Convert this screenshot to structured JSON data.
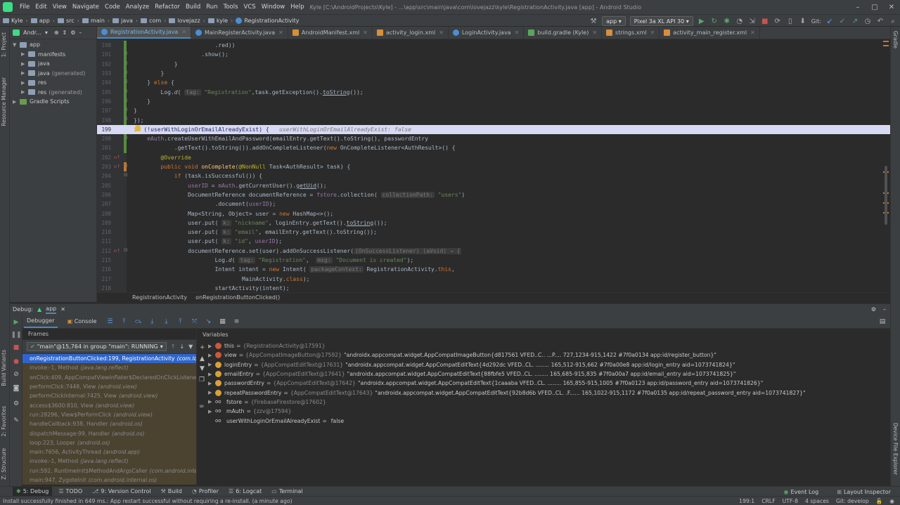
{
  "menu": {
    "items": [
      "File",
      "Edit",
      "View",
      "Navigate",
      "Code",
      "Analyze",
      "Refactor",
      "Build",
      "Run",
      "Tools",
      "VCS",
      "Window",
      "Help"
    ],
    "title": "Kyle [C:\\AndroidProjects\\Kyle] - ...\\app\\src\\main\\java\\com\\lovejazz\\kyle\\RegistrationActivity.java [app] - Android Studio"
  },
  "navbar": {
    "crumbs": [
      "Kyle",
      "app",
      "src",
      "main",
      "java",
      "com",
      "lovejazz",
      "kyle",
      "RegistrationActivity"
    ],
    "run_config": "app",
    "device": "Pixel 3a XL API 30",
    "git_label": "Git:"
  },
  "left_stripe": [
    "1: Project",
    "Resource Manager",
    "Build Variants",
    "2: Favorites",
    "Z: Structure"
  ],
  "right_stripe": [
    "Gradle",
    "Device File Explorer"
  ],
  "project": {
    "header": "Andr...",
    "tree": [
      {
        "label": "app",
        "indent": 0,
        "expanded": true,
        "type": "folder"
      },
      {
        "label": "manifests",
        "indent": 1,
        "expanded": false,
        "type": "folder"
      },
      {
        "label": "java",
        "indent": 1,
        "expanded": false,
        "type": "folder"
      },
      {
        "label": "java",
        "suffix": "(generated)",
        "indent": 1,
        "expanded": false,
        "type": "folder"
      },
      {
        "label": "res",
        "indent": 1,
        "expanded": false,
        "type": "folder"
      },
      {
        "label": "res",
        "suffix": "(generated)",
        "indent": 1,
        "expanded": false,
        "type": "folder"
      },
      {
        "label": "Gradle Scripts",
        "indent": 0,
        "expanded": false,
        "type": "gradle"
      }
    ]
  },
  "tabs": [
    {
      "label": "RegistrationActivity.java",
      "icon": "class",
      "active": true
    },
    {
      "label": "MainRegisterActivity.java",
      "icon": "class",
      "active": false
    },
    {
      "label": "AndroidManifest.xml",
      "icon": "xml",
      "active": false
    },
    {
      "label": "activity_login.xml",
      "icon": "xml",
      "active": false
    },
    {
      "label": "LoginActivity.java",
      "icon": "class",
      "active": false
    },
    {
      "label": "build.gradle (Kyle)",
      "icon": "gradle",
      "active": false
    },
    {
      "label": "strings.xml",
      "icon": "xml",
      "active": false
    },
    {
      "label": "activity_main_register.xml",
      "icon": "xml",
      "active": false
    }
  ],
  "code": [
    {
      "n": "190",
      "html": "                        .red))"
    },
    {
      "n": "191",
      "html": "                    .show();"
    },
    {
      "n": "192",
      "html": "            }"
    },
    {
      "n": "193",
      "html": "        }"
    },
    {
      "n": "194",
      "html": "    } <k>else</k> {"
    },
    {
      "n": "195",
      "html": "        Log.<i>d</i>( <h>tag:</h> <s>\"Registration\"</s>,task.getException().<u>toString</u>());"
    },
    {
      "n": "196",
      "html": "    }"
    },
    {
      "n": "197",
      "html": "}"
    },
    {
      "n": "198",
      "html": "});"
    },
    {
      "n": "199",
      "html": "<k>if</k> (!userWithLoginOrEmailAlreadyExist) {   <c>userWithLoginOrEmailAlreadyExist: false</c>",
      "exec": true
    },
    {
      "n": "200",
      "html": "    <f>mAuth</f>.createUserWithEmailAndPassword(emailEntry.getText().toString(), passwordEntry"
    },
    {
      "n": "201",
      "html": "            .getText().toString()).addOnCompleteListener(<k>new</k> OnCompleteListener&lt;AuthResult&gt;() {"
    },
    {
      "n": "202",
      "html": "        <a>@Override</a>"
    },
    {
      "n": "203",
      "html": "        <k>public void</k> <y>onComplete</y>(<a>@NonNull</a> Task&lt;AuthResult&gt; task) {"
    },
    {
      "n": "204",
      "html": "            <k>if</k> (task.isSuccessful()) {"
    },
    {
      "n": "205",
      "html": "                <f>userID</f> = <f>mAuth</f>.getCurrentUser().<u>getUid</u>();"
    },
    {
      "n": "206",
      "html": "                DocumentReference documentReference = <f>fstore</f>.collection( <h>collectionPath:</h> <s>\"users\"</s>)"
    },
    {
      "n": "207",
      "html": "                        .document(<f>userID</f>);"
    },
    {
      "n": "208",
      "html": "                Map&lt;String, Object&gt; user = <k>new</k> HashMap&lt;&gt;();"
    },
    {
      "n": "209",
      "html": "                user.put( <h>k:</h> <s>\"nickname\"</s>, loginEntry.getText().<u>toString</u>());"
    },
    {
      "n": "210",
      "html": "                user.put( <h>k:</h> <s>\"email\"</s>, emailEntry.getText().toString());"
    },
    {
      "n": "211",
      "html": "                user.put( <h>k:</h> <s>\"id\"</s>, <f>userID</f>);"
    },
    {
      "n": "212",
      "html": "                documentReference.set(user).addOnSuccessListener(<h>(OnSuccessListener) (aVoid) → {</h>"
    },
    {
      "n": "215",
      "html": "                        Log.<i>d</i>( <h>tag:</h> <s>\"Registration\"</s>,  <h>msg:</h> <s>\"Document is created\"</s>);"
    },
    {
      "n": "216",
      "html": "                        Intent intent = <k>new</k> Intent( <h>packageContext:</h> RegistrationActivity.<k>this</k>,"
    },
    {
      "n": "217",
      "html": "                                MainActivity.<k>class</k>);"
    },
    {
      "n": "218",
      "html": "                        startActivity(intent);"
    }
  ],
  "editor_breadcrumb": [
    "RegistrationActivity",
    "onRegistrationButtonClicked()"
  ],
  "debug": {
    "label": "Debug:",
    "config": "app",
    "tabs": [
      "Debugger",
      "Console"
    ],
    "frames_title": "Frames",
    "variables_title": "Variables",
    "thread": "\"main\"@15,764 in group \"main\": RUNNING",
    "frames": [
      {
        "text": "onRegistrationButtonClicked:199, RegistrationActivity",
        "pkg": "(com.lovejazz",
        "selected": true
      },
      {
        "text": "invoke:-1, Method",
        "pkg": "(java.lang.reflect)",
        "selected": false
      },
      {
        "text": "onClick:409, AppCompatViewInflater$DeclaredOnClickListener",
        "pkg": "(an",
        "selected": false
      },
      {
        "text": "performClick:7448, View",
        "pkg": "(android.view)",
        "selected": false
      },
      {
        "text": "performClickInternal:7425, View",
        "pkg": "(android.view)",
        "selected": false
      },
      {
        "text": "access$3600:810, View",
        "pkg": "(android.view)",
        "selected": false
      },
      {
        "text": "run:28296, View$PerformClick",
        "pkg": "(android.view)",
        "selected": false
      },
      {
        "text": "handleCallback:938, Handler",
        "pkg": "(android.os)",
        "selected": false
      },
      {
        "text": "dispatchMessage:99, Handler",
        "pkg": "(android.os)",
        "selected": false
      },
      {
        "text": "loop:223, Looper",
        "pkg": "(android.os)",
        "selected": false
      },
      {
        "text": "main:7656, ActivityThread",
        "pkg": "(android.app)",
        "selected": false
      },
      {
        "text": "invoke:-1, Method",
        "pkg": "(java.lang.reflect)",
        "selected": false
      },
      {
        "text": "run:592, RuntimeInit$MethodAndArgsCaller",
        "pkg": "(com.android.internal",
        "selected": false
      },
      {
        "text": "main:947, ZygoteInit",
        "pkg": "(com.android.internal.os)",
        "selected": false
      }
    ],
    "variables": [
      {
        "name": "this",
        "type": "{RegistrationActivity@17591}",
        "value": "",
        "icon": "t",
        "expand": true
      },
      {
        "name": "view",
        "type": "{AppCompatImageButton@17592}",
        "value": "\"androidx.appcompat.widget.AppCompatImageButton{d817561 VFED..C.. ...P.... 727,1234-915,1422 #7f0a0134 app:id/register_button}\"",
        "icon": "t",
        "expand": true
      },
      {
        "name": "loginEntry",
        "type": "{AppCompatEditText@17631}",
        "value": "\"androidx.appcompat.widget.AppCompatEditText{4d292dc VFED..CL. ........ 165,512-915,662 #7f0a00e8 app:id/login_entry aid=1073741824}\"",
        "icon": "f",
        "expand": true
      },
      {
        "name": "emailEntry",
        "type": "{AppCompatEditText@17641}",
        "value": "\"androidx.appcompat.widget.AppCompatEditText{88fbfe5 VFED..CL. ........ 165,685-915,835 #7f0a00a7 app:id/email_entry aid=1073741825}\"",
        "icon": "f",
        "expand": true
      },
      {
        "name": "passwordEntry",
        "type": "{AppCompatEditText@17642}",
        "value": "\"androidx.appcompat.widget.AppCompatEditText{1caaaba VFED..CL. ........ 165,855-915,1005 #7f0a0123 app:id/password_entry aid=1073741826}\"",
        "icon": "f",
        "expand": true
      },
      {
        "name": "repeatPasswordEntry",
        "type": "{AppCompatEditText@17643}",
        "value": "\"androidx.appcompat.widget.AppCompatEditText{92b8d6b VFED..CL. .F...... 165,1022-915,1172 #7f0a0135 app:id/repeat_password_entry aid=1073741827}\"",
        "icon": "f",
        "expand": true
      },
      {
        "name": "fstore",
        "type": "{FirebaseFirestore@17602}",
        "value": "",
        "icon": "oo",
        "expand": true
      },
      {
        "name": "mAuth",
        "type": "{zzv@17594}",
        "value": "",
        "icon": "oo",
        "expand": true
      },
      {
        "name": "userWithLoginOrEmailAlreadyExist",
        "type": "",
        "value": "false",
        "icon": "oo",
        "expand": false
      }
    ]
  },
  "bottom_tabs": [
    {
      "label": "5: Debug",
      "active": true
    },
    {
      "label": "TODO",
      "active": false
    },
    {
      "label": "9: Version Control",
      "active": false
    },
    {
      "label": "Build",
      "active": false
    },
    {
      "label": "Profiler",
      "active": false
    },
    {
      "label": "6: Logcat",
      "active": false
    },
    {
      "label": "Terminal",
      "active": false
    }
  ],
  "bottom_right": [
    "Event Log",
    "Layout Inspector"
  ],
  "status": {
    "message": "Install successfully finished in 649 ms.: App restart successful without requiring a re-install. (a minute ago)",
    "position": "199:1",
    "line_sep": "CRLF",
    "encoding": "UTF-8",
    "indent": "4 spaces",
    "git": "Git: develop"
  },
  "colors": {
    "bg": "#2b2b2b",
    "panel": "#3c3f41",
    "accent": "#4a88c7",
    "exec_line": "#d8d9f4",
    "frame_selected": "#2f65ca"
  }
}
